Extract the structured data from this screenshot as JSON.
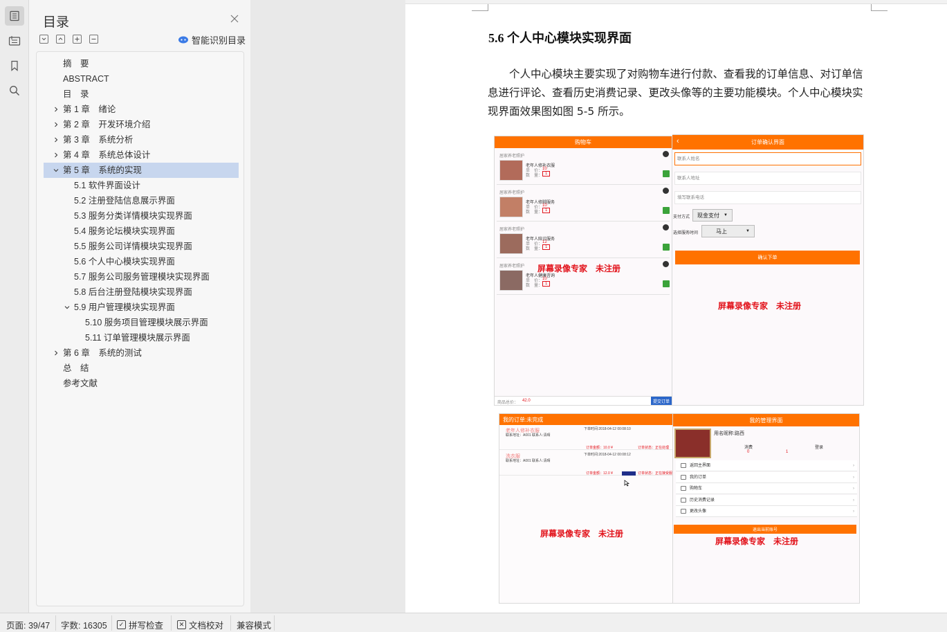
{
  "toc": {
    "title": "目录",
    "ai_button": "智能识别目录",
    "items": [
      {
        "label": "摘　要",
        "level": 0,
        "expander": "none"
      },
      {
        "label": "ABSTRACT",
        "level": 0,
        "expander": "none"
      },
      {
        "label": "目　录",
        "level": 0,
        "expander": "none"
      },
      {
        "label": "第 1 章　绪论",
        "level": 0,
        "expander": "collapsed"
      },
      {
        "label": "第 2 章　开发环境介绍",
        "level": 0,
        "expander": "collapsed"
      },
      {
        "label": "第 3 章　系统分析",
        "level": 0,
        "expander": "collapsed"
      },
      {
        "label": "第 4 章　系统总体设计",
        "level": 0,
        "expander": "collapsed"
      },
      {
        "label": "第 5 章　系统的实现",
        "level": 0,
        "expander": "expanded",
        "selected": true
      },
      {
        "label": "5.1  软件界面设计",
        "level": 1,
        "expander": "none"
      },
      {
        "label": "5.2  注册登陆信息展示界面",
        "level": 1,
        "expander": "none"
      },
      {
        "label": "5.3  服务分类详情模块实现界面",
        "level": 1,
        "expander": "none"
      },
      {
        "label": "5.4  服务论坛模块实现界面",
        "level": 1,
        "expander": "none"
      },
      {
        "label": "5.5 服务公司详情模块实现界面",
        "level": 1,
        "expander": "none"
      },
      {
        "label": "5.6 个人中心模块实现界面",
        "level": 1,
        "expander": "none"
      },
      {
        "label": "5.7 服务公司服务管理模块实现界面",
        "level": 1,
        "expander": "none"
      },
      {
        "label": "5.8  后台注册登陆模块实现界面",
        "level": 1,
        "expander": "none"
      },
      {
        "label": "5.9  用户管理模块实现界面",
        "level": 1,
        "expander": "expanded"
      },
      {
        "label": "5.10  服务项目管理模块展示界面",
        "level": 2,
        "expander": "none"
      },
      {
        "label": "5.11 订单管理模块展示界面",
        "level": 2,
        "expander": "none"
      },
      {
        "label": "第 6 章　系统的测试",
        "level": 0,
        "expander": "collapsed"
      },
      {
        "label": "总　结",
        "level": 0,
        "expander": "none"
      },
      {
        "label": "参考文献",
        "level": 0,
        "expander": "none"
      }
    ]
  },
  "document": {
    "heading": "5.6 个人中心模块实现界面",
    "paragraph": "个人中心模块主要实现了对购物车进行付款、查看我的订单信息、对订单信息进行评论、查看历史消费记录、更改头像等的主要功能模块。个人中心模块实现界面效果图如图 5-5 所示。"
  },
  "figure": {
    "watermark": "屏幕录像专家　未注册",
    "cart": {
      "title": "购物车",
      "items": [
        {
          "shop": "居家养老照护",
          "name": "老年人修补衣服",
          "price": "10",
          "qty": "1"
        },
        {
          "shop": "居家养老照护",
          "name": "老年人修脚服务",
          "price": "10",
          "qty": "1"
        },
        {
          "shop": "居家养老照护",
          "name": "老年人陪诊服务",
          "price": "12",
          "qty": "1"
        },
        {
          "shop": "居家养老照护",
          "name": "老年人健康咨询",
          "price": "10",
          "qty": "1"
        }
      ],
      "price_label": "单　价：",
      "qty_label": "数　量：",
      "total_label": "商品总价：",
      "total_value": "42.0",
      "submit": "提交订单"
    },
    "confirm": {
      "title": "订单确认界面",
      "name_placeholder": "联系人姓名",
      "addr_placeholder": "联系人地址",
      "phone_placeholder": "填写联系电话",
      "pay_label": "支付方式",
      "pay_value": "现金支付",
      "time_label": "选择服务时间",
      "time_value": "马上",
      "confirm_button": "确认下单"
    },
    "orders": {
      "title": "我的订单:未完成",
      "rows": [
        {
          "name": "老年人修补衣服",
          "addr": "联系地址：A001 联系人:清晴",
          "time": "下单时间:2018-04-12 00:08:10",
          "amount": "订单金额：10.0 ¥",
          "status": "订单状态：正在处理"
        },
        {
          "name": "洗衣服",
          "addr": "联系地址：A001 联系人:清晴",
          "time": "下单时间:2018-04-12 00:08:12",
          "amount": "订单金额：12.0 ¥",
          "status": "订单状态：正在接受服务"
        }
      ]
    },
    "manage": {
      "title": "我的管理界面",
      "username": "用名昵称:路西",
      "col1_label": "消费",
      "col1_value": "0",
      "col2_label": "登录",
      "col2_value": "1",
      "menu": [
        "返回主界面",
        "我的订单",
        "购物车",
        "历史消费记录",
        "更改头像"
      ],
      "logout": "退出当前账号"
    }
  },
  "status": {
    "page": "页面: 39/47",
    "words": "字数: 16305",
    "spell": "拼写检查",
    "proof": "文档校对",
    "compat": "兼容模式"
  }
}
